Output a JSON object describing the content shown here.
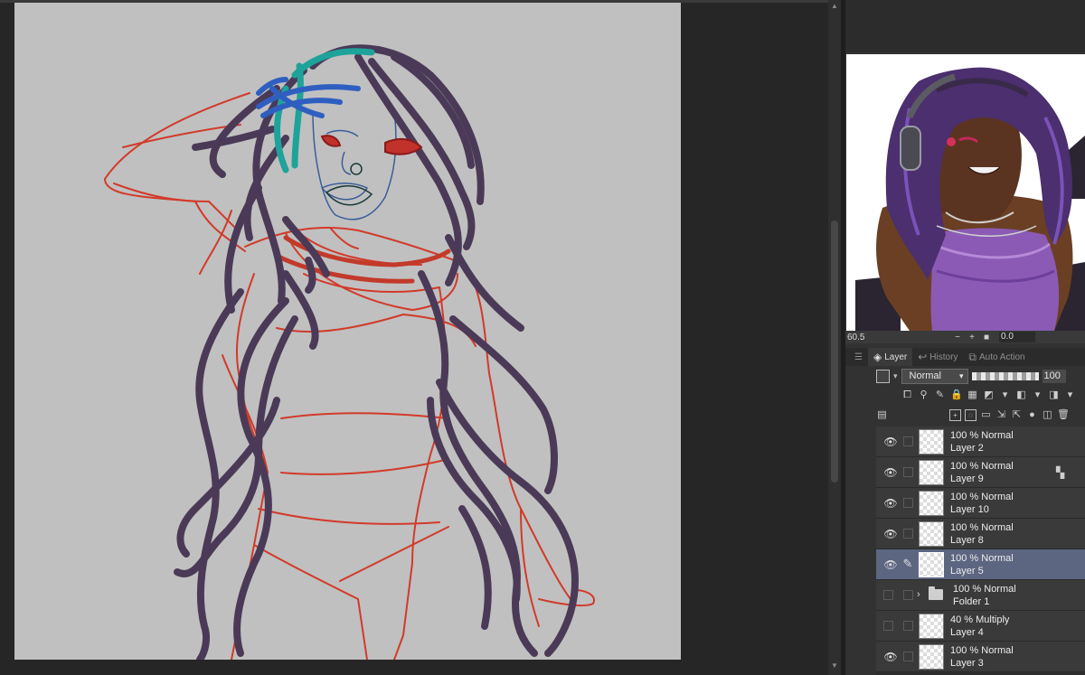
{
  "palette": {
    "canvas_paper": "#c0c0c0",
    "hair_stroke": "#4a3a57",
    "body_lines": "#d23a2a",
    "accent_teal": "#1ea39a",
    "accent_blue": "#2e5fc0",
    "selected_layer": "#5d6681"
  },
  "navigator": {
    "zoom": "60.5",
    "zoom_out": "−",
    "zoom_in": "+",
    "stop": "■",
    "angle": "0.0"
  },
  "tabs": [
    {
      "label": "Layer",
      "icon": "layers-icon"
    },
    {
      "label": "History",
      "icon": "history-icon"
    },
    {
      "label": "Auto Action",
      "icon": "auto-action-icon"
    }
  ],
  "layer_properties": {
    "blend_mode": "Normal",
    "opacity": "100"
  },
  "layers": [
    {
      "mode": "100 % Normal",
      "name": "Layer 2",
      "visible": true
    },
    {
      "mode": "100 % Normal",
      "name": "Layer 9",
      "visible": true
    },
    {
      "mode": "100 % Normal",
      "name": "Layer 10",
      "visible": true
    },
    {
      "mode": "100 % Normal",
      "name": "Layer 8",
      "visible": true
    },
    {
      "mode": "100 % Normal",
      "name": "Layer 5",
      "visible": true,
      "selected": true
    },
    {
      "mode": "100 % Normal",
      "name": "Folder 1",
      "visible": false,
      "folder": true
    },
    {
      "mode": "40 % Multiply",
      "name": "Layer 4",
      "visible": false
    },
    {
      "mode": "100 % Normal",
      "name": "Layer 3",
      "visible": true
    }
  ]
}
